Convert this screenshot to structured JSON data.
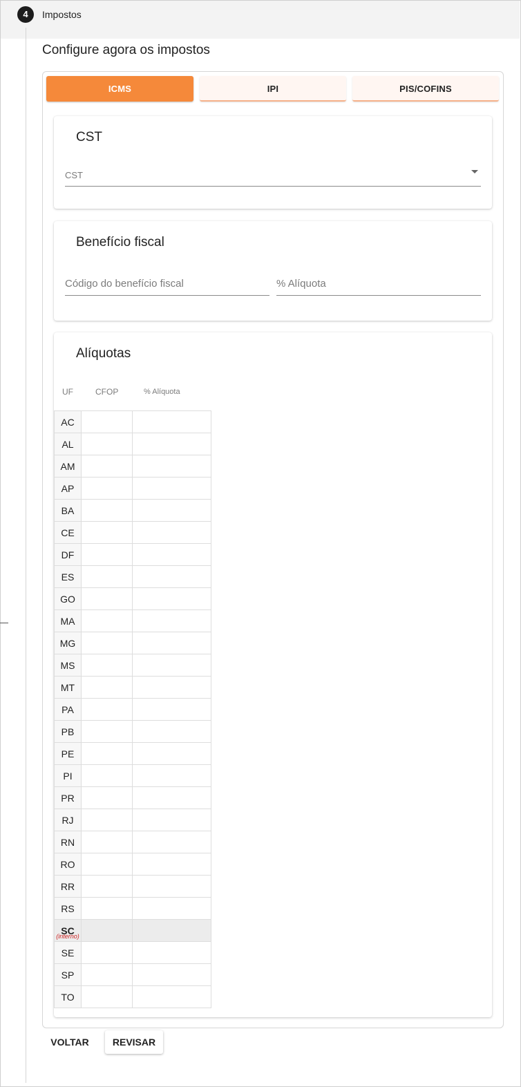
{
  "step": {
    "number": "4",
    "title": "Impostos"
  },
  "page_title": "Configure agora os impostos",
  "tabs": [
    {
      "label": "ICMS",
      "active": true
    },
    {
      "label": "IPI",
      "active": false
    },
    {
      "label": "PIS/COFINS",
      "active": false
    }
  ],
  "cst_card": {
    "title": "CST",
    "select_label": "CST",
    "select_value": ""
  },
  "beneficio_card": {
    "title": "Benefício fiscal",
    "codigo_label": "Código do benefício fiscal",
    "aliquota_label": "% Alíquota"
  },
  "aliquotas_card": {
    "title": "Alíquotas",
    "columns": [
      "UF",
      "CFOP",
      "% Alíquota"
    ],
    "rows": [
      {
        "uf": "AC",
        "note": "",
        "cfop": "",
        "aliquota": ""
      },
      {
        "uf": "AL",
        "note": "",
        "cfop": "",
        "aliquota": ""
      },
      {
        "uf": "AM",
        "note": "",
        "cfop": "",
        "aliquota": ""
      },
      {
        "uf": "AP",
        "note": "",
        "cfop": "",
        "aliquota": ""
      },
      {
        "uf": "BA",
        "note": "",
        "cfop": "",
        "aliquota": ""
      },
      {
        "uf": "CE",
        "note": "",
        "cfop": "",
        "aliquota": ""
      },
      {
        "uf": "DF",
        "note": "",
        "cfop": "",
        "aliquota": ""
      },
      {
        "uf": "ES",
        "note": "",
        "cfop": "",
        "aliquota": ""
      },
      {
        "uf": "GO",
        "note": "",
        "cfop": "",
        "aliquota": ""
      },
      {
        "uf": "MA",
        "note": "",
        "cfop": "",
        "aliquota": ""
      },
      {
        "uf": "MG",
        "note": "",
        "cfop": "",
        "aliquota": ""
      },
      {
        "uf": "MS",
        "note": "",
        "cfop": "",
        "aliquota": ""
      },
      {
        "uf": "MT",
        "note": "",
        "cfop": "",
        "aliquota": ""
      },
      {
        "uf": "PA",
        "note": "",
        "cfop": "",
        "aliquota": ""
      },
      {
        "uf": "PB",
        "note": "",
        "cfop": "",
        "aliquota": ""
      },
      {
        "uf": "PE",
        "note": "",
        "cfop": "",
        "aliquota": ""
      },
      {
        "uf": "PI",
        "note": "",
        "cfop": "",
        "aliquota": ""
      },
      {
        "uf": "PR",
        "note": "",
        "cfop": "",
        "aliquota": ""
      },
      {
        "uf": "RJ",
        "note": "",
        "cfop": "",
        "aliquota": ""
      },
      {
        "uf": "RN",
        "note": "",
        "cfop": "",
        "aliquota": ""
      },
      {
        "uf": "RO",
        "note": "",
        "cfop": "",
        "aliquota": ""
      },
      {
        "uf": "RR",
        "note": "",
        "cfop": "",
        "aliquota": ""
      },
      {
        "uf": "RS",
        "note": "",
        "cfop": "",
        "aliquota": ""
      },
      {
        "uf": "SC",
        "note": "(interno)",
        "cfop": "",
        "aliquota": ""
      },
      {
        "uf": "SE",
        "note": "",
        "cfop": "",
        "aliquota": ""
      },
      {
        "uf": "SP",
        "note": "",
        "cfop": "",
        "aliquota": ""
      },
      {
        "uf": "TO",
        "note": "",
        "cfop": "",
        "aliquota": ""
      }
    ]
  },
  "buttons": {
    "back": "VOLTAR",
    "review": "REVISAR"
  },
  "colors": {
    "accent": "#f5893a",
    "tab_inactive_bg": "#fff6f2",
    "interno_note": "#cc1f1f"
  }
}
